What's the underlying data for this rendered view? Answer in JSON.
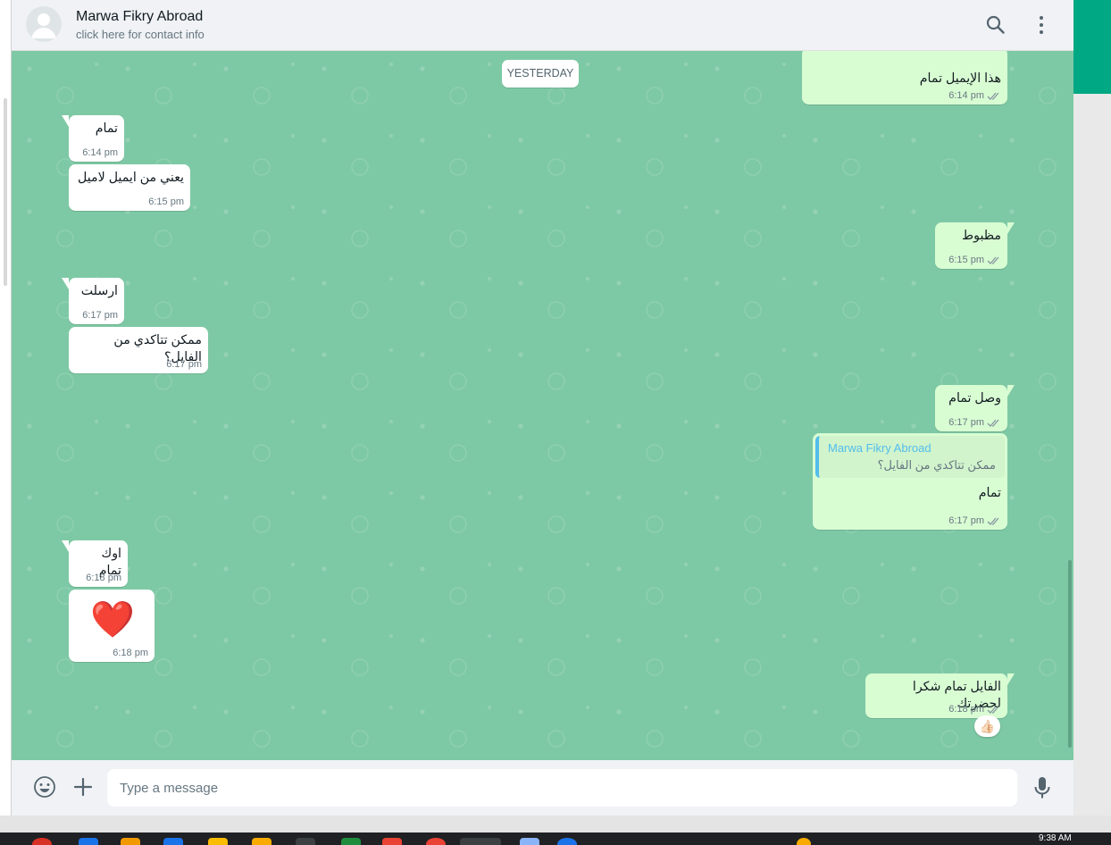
{
  "header": {
    "contact_name": "Marwa Fikry Abroad",
    "contact_sub": "click here for contact info"
  },
  "chat": {
    "day_label": "YESTERDAY",
    "messages": [
      {
        "dir": "out",
        "text": "هذا الإيميل تمام",
        "time": "6:14 pm",
        "ticks": true
      },
      {
        "dir": "in",
        "text": "تمام",
        "time": "6:14 pm"
      },
      {
        "dir": "in",
        "text": "يعني من ايميل لاميل",
        "time": "6:15 pm"
      },
      {
        "dir": "out",
        "text": "مظبوط",
        "time": "6:15 pm",
        "ticks": true
      },
      {
        "dir": "in",
        "text": "ارسلت",
        "time": "6:17 pm"
      },
      {
        "dir": "in",
        "text": "ممكن تتاكدي من الفايل؟",
        "time": "6:17 pm"
      },
      {
        "dir": "out",
        "text": "وصل تمام",
        "time": "6:17 pm",
        "ticks": true
      },
      {
        "dir": "out",
        "text": "تمام",
        "time": "6:17 pm",
        "ticks": true,
        "quote": {
          "name": "Marwa Fikry Abroad",
          "text": "ممكن تتاكدي من الفايل؟"
        }
      },
      {
        "dir": "in",
        "text": "اوك تمام",
        "time": "6:18 pm"
      },
      {
        "dir": "in",
        "text": "❤️",
        "time": "6:18 pm",
        "emoji": true
      },
      {
        "dir": "out",
        "text": "الفايل تمام شكرا لحضرتك",
        "time": "6:18 pm",
        "ticks": true,
        "reaction": "👍🏻"
      }
    ]
  },
  "footer": {
    "placeholder": "Type a message"
  },
  "taskbar": {
    "time": "9:38 AM"
  },
  "colors": {
    "chat_bg": "#7ec9a5",
    "incoming": "#ffffff",
    "outgoing": "#d9fdd3",
    "accent": "#00a884",
    "quote_bar": "#53bdeb"
  }
}
